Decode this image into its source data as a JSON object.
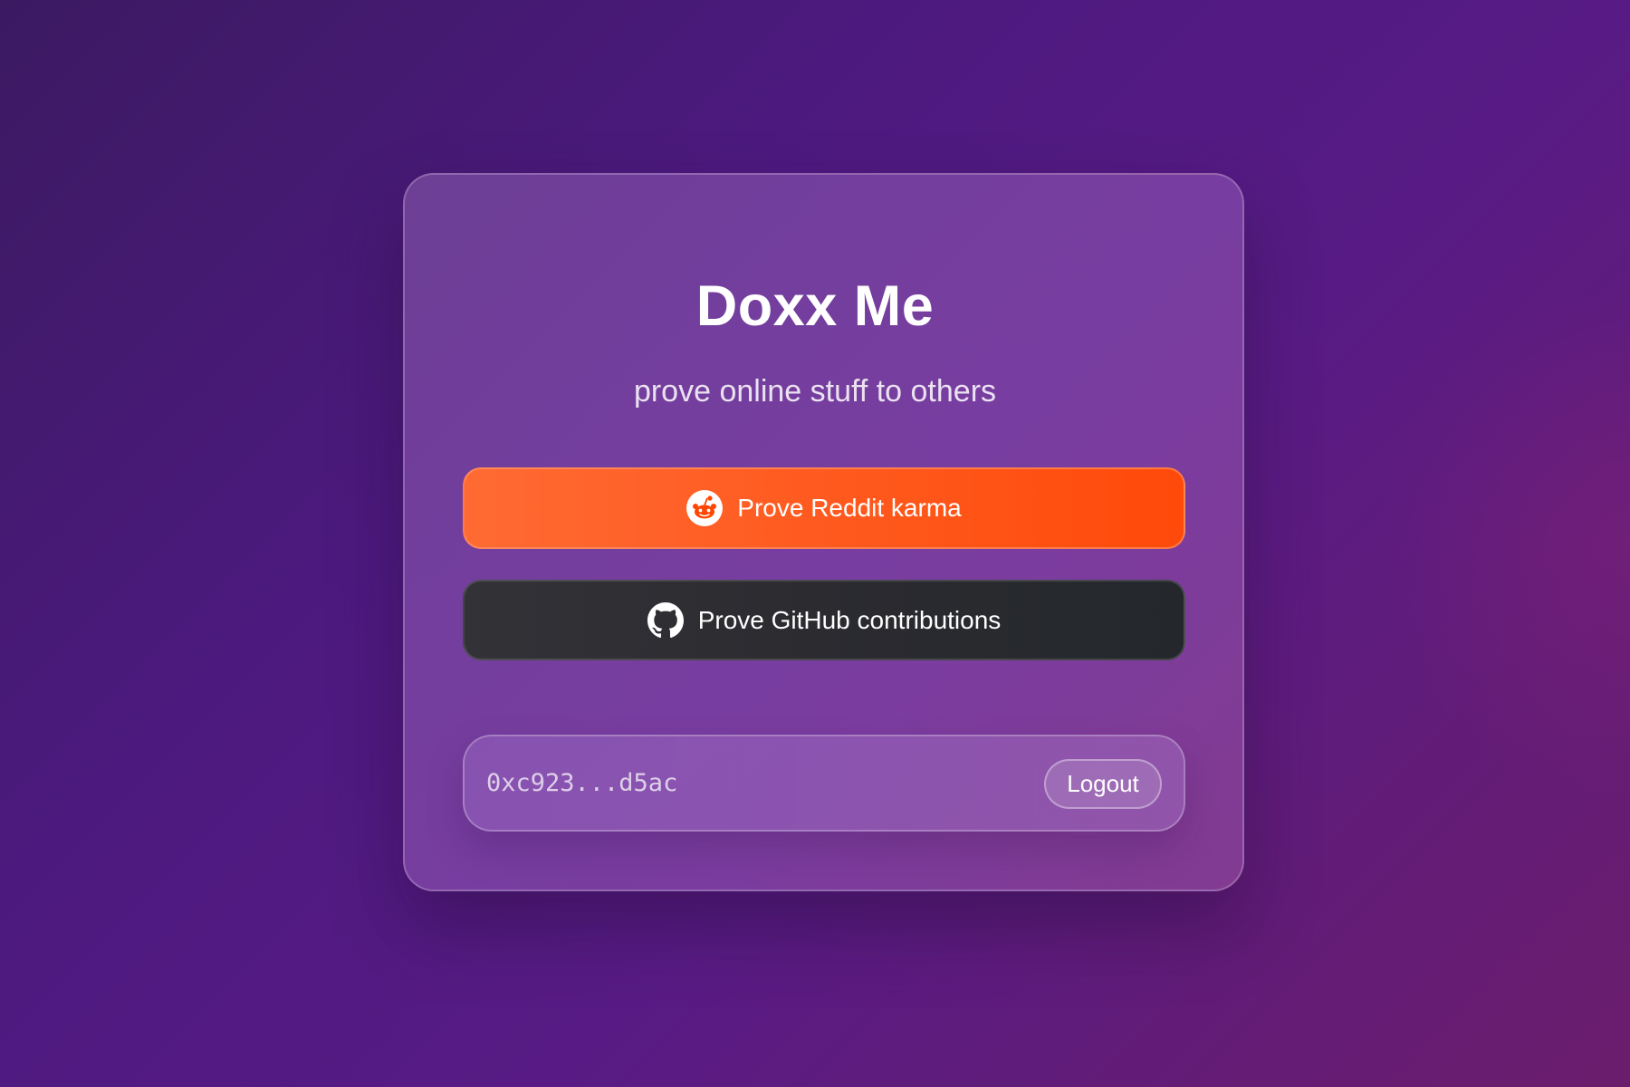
{
  "app": {
    "title": "Doxx Me",
    "subtitle": "prove online stuff to others"
  },
  "actions": {
    "reddit": {
      "label": "Prove Reddit karma",
      "icon": "reddit-icon",
      "color": "#ff5a1f"
    },
    "github": {
      "label": "Prove GitHub contributions",
      "icon": "github-icon",
      "color": "#2b2b30"
    }
  },
  "wallet": {
    "address": "0xc923...d5ac",
    "logout_label": "Logout"
  },
  "colors": {
    "background_start": "#3c1a62",
    "background_end": "#6b1d6c",
    "reddit_orange": "#ff4500"
  }
}
